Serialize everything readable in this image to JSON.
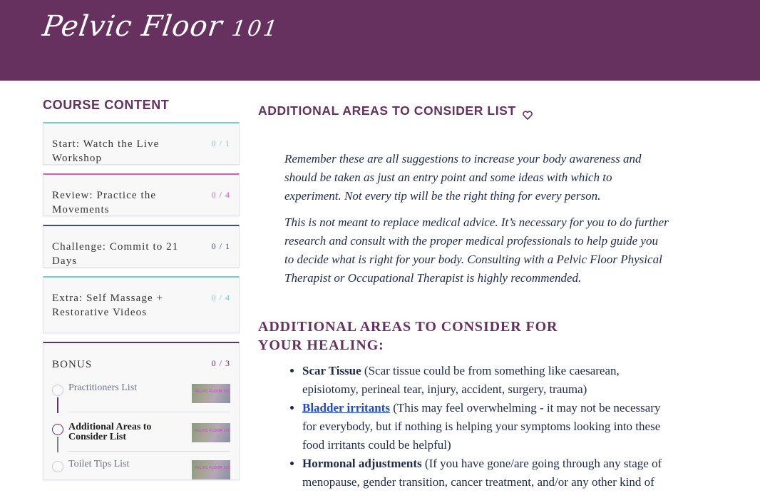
{
  "header": {
    "logo_text": "Pelvic Floor",
    "logo_number": "101",
    "background_color": "#66305f"
  },
  "sidebar": {
    "heading": "COURSE CONTENT",
    "sections": [
      {
        "title": "Start: Watch the Live Workshop",
        "progress": "0 / 1",
        "accent": "#6cd0d2"
      },
      {
        "title": "Review: Practice the Movements",
        "progress": "0 / 4",
        "accent": "#d45bbf"
      },
      {
        "title": "Challenge: Commit to 21 Days",
        "progress": "0 / 1",
        "accent": "#3e4f72"
      },
      {
        "title": "Extra: Self Massage + Restorative Videos",
        "progress": "0 / 4",
        "accent": "#6cd0d2"
      },
      {
        "title": "BONUS",
        "progress": "0 / 3",
        "accent": "#66305f",
        "lessons": [
          {
            "title": "Practitioners List",
            "thumb_text": "PELVIC FLOOR 101",
            "active": false
          },
          {
            "title": "Additional Areas to Consider List",
            "thumb_text": "PELVIC FLOOR 101",
            "active": true
          },
          {
            "title": "Toilet Tips List",
            "thumb_text": "PELVIC FLOOR 101",
            "active": false
          }
        ]
      }
    ]
  },
  "main": {
    "title": "ADDITIONAL AREAS TO CONSIDER LIST",
    "favorite_icon": "heart-icon",
    "intro": [
      "Remember these are all suggestions to increase your body awareness and should be taken as just an entry point and some ideas with which to experiment. Not every tip will be the right thing for every person.",
      "This is not meant to replace medical advice. It’s necessary for you to do further research and consult with the proper medical professionals to help guide you to decide what is right for your body. Consulting with a Pelvic Floor Physical Therapist or Occupational Therapist is highly recommended."
    ],
    "section_heading": "ADDITIONAL AREAS TO CONSIDER FOR YOUR HEALING:",
    "areas": [
      {
        "term": "Scar Tissue",
        "is_link": false,
        "text": " (Scar tissue could be from something like caesarean, episiotomy, perineal tear, injury, accident, surgery, trauma)"
      },
      {
        "term": "Bladder irritants",
        "is_link": true,
        "text": " (This may feel overwhelming - it may not be necessary for everybody, but if nothing is helping your symptoms looking into these food irritants could be helpful)"
      },
      {
        "term": "Hormonal adjustments",
        "is_link": false,
        "text": " (If you have gone/are going through any stage of menopause, gender transition, cancer treatment, and/or any other kind of"
      }
    ]
  }
}
